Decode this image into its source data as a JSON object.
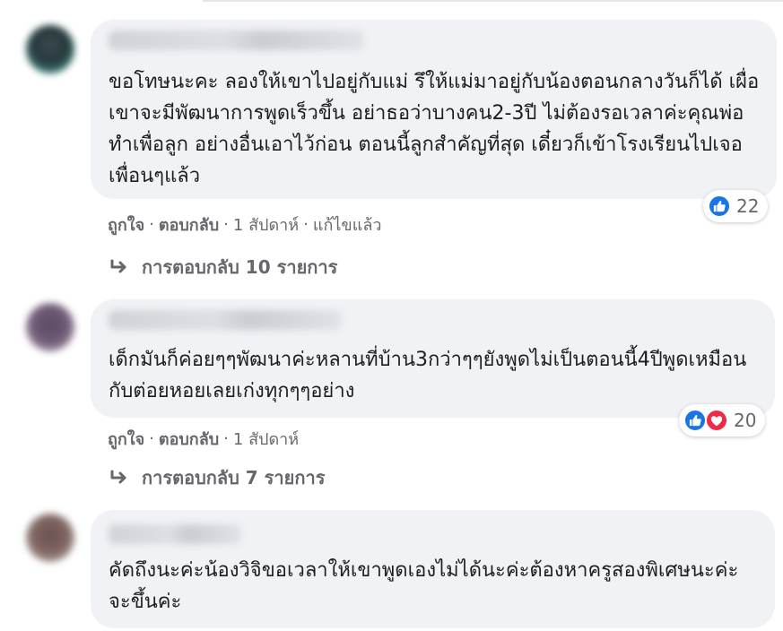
{
  "comments": [
    {
      "text": "ขอโทษนะคะ ลองให้เขาไปอยู่กับแม่ รึให้แม่มาอยู่กับน้องตอนกลางวันก็ได้ เผื่อเขาจะมีพัฒนาการพูดเร็วขึ้น อย่าธอว่าบางคน2-3ปี ไม่ต้องรอเวลาค่ะคุณพ่อ ทำเพื่อลูก อย่างอื่นเอาไว้ก่อน ตอนนี้ลูกสำคัญที่สุด เดี๋ยวก็เข้าโรงเรียนไปเจอเพื่อนๆแล้ว",
      "reaction_count": "22",
      "reaction_icons": [
        "like-icon"
      ],
      "like_label": "ถูกใจ",
      "reply_label": "ตอบกลับ",
      "time": "1 สัปดาห์",
      "edited": "แก้ไขแล้ว",
      "replies_text": "การตอบกลับ 10 รายการ"
    },
    {
      "text": "เด็กมันก็ค่อยๆๆพัฒนาค่ะหลานที่บ้าน3กว่าๆๆยังพูดไม่เป็นตอนนี้4ปีพูดเหมือนกับต่อยหอยเลยเก่งทุกๆๆอย่าง",
      "reaction_count": "20",
      "reaction_icons": [
        "like-icon",
        "love-icon"
      ],
      "like_label": "ถูกใจ",
      "reply_label": "ตอบกลับ",
      "time": "1 สัปดาห์",
      "replies_text": "การตอบกลับ 7 รายการ"
    },
    {
      "text": "คัดถึงนะค่ะน้องวิจิขอเวลาให้เขาพูดเองไม่ได้นะค่ะต้องหาครูสองพิเศษนะค่ะจะขึ้นค่ะ"
    }
  ],
  "colors": {
    "bubble": "#f0f2f5",
    "text": "#1c1e21",
    "meta": "#65676b",
    "like": "#1b74e4",
    "love": "#f0284a"
  }
}
